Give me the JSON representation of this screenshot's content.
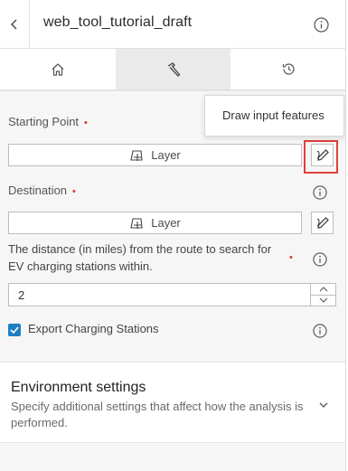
{
  "header": {
    "title": "web_tool_tutorial_draft",
    "back_icon": "chevron-left-icon",
    "info_icon": "info-icon"
  },
  "tabs": [
    {
      "icon": "home-icon",
      "active": false
    },
    {
      "icon": "hammer-icon",
      "active": true
    },
    {
      "icon": "history-icon",
      "active": false
    }
  ],
  "tooltip": {
    "text": "Draw input features"
  },
  "form": {
    "starting_point": {
      "label": "Starting Point",
      "required_marker": "•",
      "layer_label": "Layer"
    },
    "destination": {
      "label": "Destination",
      "required_marker": "•",
      "layer_label": "Layer"
    },
    "distance": {
      "label": "The distance (in miles) from the route to search for EV charging stations within.",
      "required_marker": "•",
      "value": "2"
    },
    "export": {
      "label": "Export Charging Stations",
      "checked": true
    }
  },
  "environment": {
    "title": "Environment settings",
    "description": "Specify additional settings that affect how the analysis is performed."
  },
  "colors": {
    "accent": "#1e7fc4",
    "required": "#d83020",
    "highlight": "#e0403a"
  }
}
